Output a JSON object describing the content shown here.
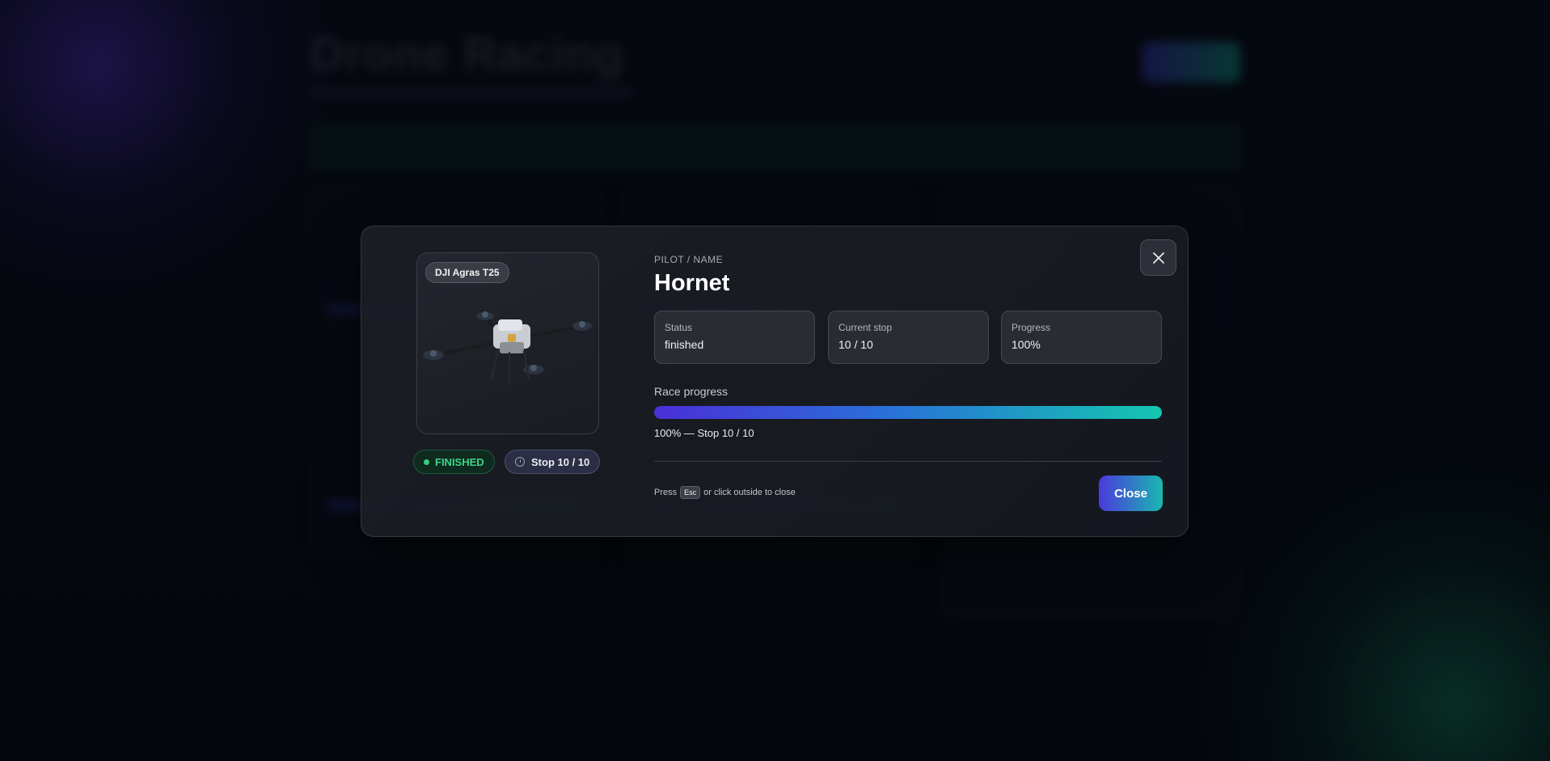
{
  "background": {
    "title": "Drone Racing"
  },
  "modal": {
    "model": "DJI Agras T25",
    "status_badge": "FINISHED",
    "stop_badge": "Stop 10 / 10",
    "pilot_label": "PILOT / NAME",
    "pilot_name": "Hornet",
    "stats": {
      "status_label": "Status",
      "status_value": "finished",
      "stop_label": "Current stop",
      "stop_value": "10 / 10",
      "progress_label": "Progress",
      "progress_value": "100%"
    },
    "race_progress_label": "Race progress",
    "race_progress_fraction": 1.0,
    "race_progress_text": "100% — Stop 10 / 10",
    "hint_press": "Press",
    "hint_key": "Esc",
    "hint_rest": "or click outside to close",
    "close_label": "Close",
    "icons": {
      "close": "close-icon",
      "drone": "drone-image",
      "clock": "clock-icon"
    }
  },
  "colors": {
    "accent_start": "#4b39dc",
    "accent_end": "#1ab7b0",
    "finished": "#3ed48a"
  }
}
